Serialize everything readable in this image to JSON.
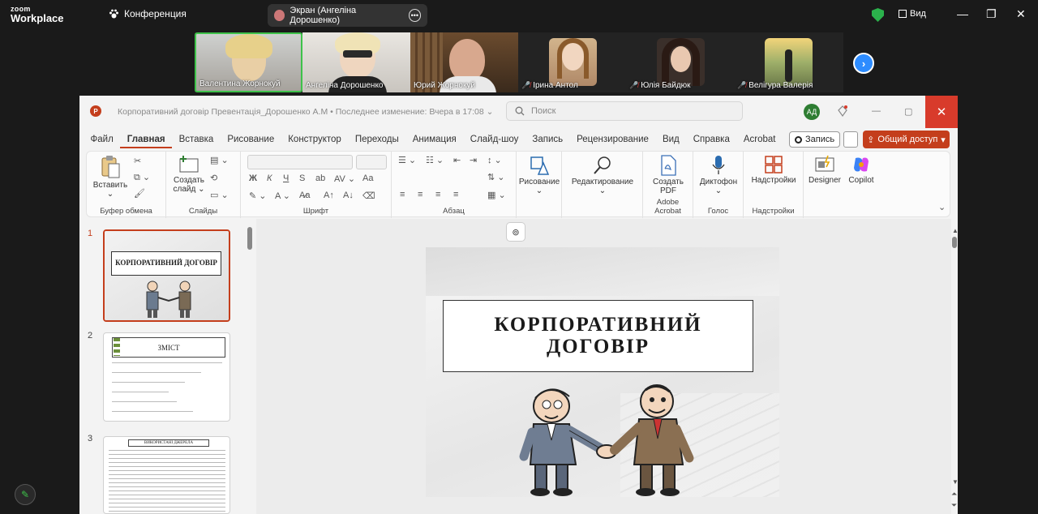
{
  "zoom": {
    "logo_top": "zoom",
    "logo_bottom": "Workplace",
    "conference_label": "Конференция",
    "share_label": "Экран (Ангеліна Дорошенко)",
    "view_label": "Вид"
  },
  "participants": [
    {
      "name": "Валентина Жорнокуй",
      "muted": false
    },
    {
      "name": "Ангеліна Дорошенко",
      "muted": false
    },
    {
      "name": "Юрий Жорнокуй",
      "muted": false
    },
    {
      "name": "Ірина Антол",
      "muted": true
    },
    {
      "name": "Юлія Байдюк",
      "muted": true
    },
    {
      "name": "Велігура Валерія",
      "muted": true
    }
  ],
  "ppt": {
    "app_icon_letter": "P",
    "document_title": "Корпоративний договір Превентація_Дорошенко А.М  •  Последнее изменение: Вчера в 17:08",
    "search_placeholder": "Поиск",
    "user_initials": "АД",
    "tabs": [
      "Файл",
      "Главная",
      "Вставка",
      "Рисование",
      "Конструктор",
      "Переходы",
      "Анимация",
      "Слайд-шоу",
      "Запись",
      "Рецензирование",
      "Вид",
      "Справка",
      "Acrobat"
    ],
    "active_tab": "Главная",
    "record_label": "Запись",
    "share_label": "Общий доступ",
    "ribbon": {
      "paste": "Вставить",
      "clipboard": "Буфер обмена",
      "new_slide_1": "Создать",
      "new_slide_2": "слайд",
      "slides": "Слайды",
      "font": "Шрифт",
      "paragraph": "Абзац",
      "drawing": "Рисование",
      "editing": "Редактирование",
      "create_pdf_1": "Создать",
      "create_pdf_2": "PDF",
      "adobe": "Adobe Acrobat",
      "dictation": "Диктофон",
      "voice": "Голос",
      "addins": "Надстройки",
      "addins_group": "Надстройки",
      "designer": "Designer",
      "copilot": "Copilot"
    },
    "slides": [
      {
        "num": "1",
        "title": "КОРПОРАТИВНИЙ ДОГОВІР"
      },
      {
        "num": "2",
        "title": "ЗМІСТ"
      },
      {
        "num": "3",
        "title": "ВИКОРИСТАНІ ДЖЕРЕЛА"
      }
    ],
    "main_slide": {
      "title_line1": "КОРПОРАТИВНИЙ",
      "title_line2": "ДОГОВІР"
    }
  }
}
